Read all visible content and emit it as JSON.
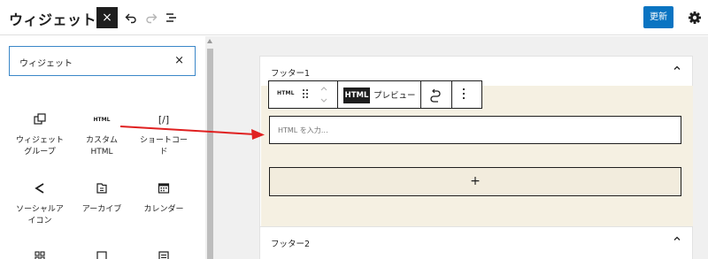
{
  "header": {
    "title": "ウィジェット",
    "close_label": "×",
    "update_label": "更新",
    "icons": [
      "undo-icon",
      "redo-icon",
      "list-view-icon",
      "gear-icon"
    ]
  },
  "sidebar": {
    "search": {
      "value": "ウィジェット",
      "clear_label": "×"
    },
    "blocks": [
      {
        "label": "ウィジェット\nグループ",
        "icon": "group-icon"
      },
      {
        "label": "カスタム\nHTML",
        "icon": "html-icon",
        "icon_text": "HTML"
      },
      {
        "label": "ショートコー\nド",
        "icon": "shortcode-icon",
        "icon_text": "[/]"
      },
      {
        "label": "ソーシャルア\nイコン",
        "icon": "share-icon"
      },
      {
        "label": "アーカイブ",
        "icon": "archive-icon"
      },
      {
        "label": "カレンダー",
        "icon": "calendar-icon"
      }
    ]
  },
  "main": {
    "panels": [
      {
        "title": "フッター1",
        "expanded": true
      },
      {
        "title": "フッター2",
        "expanded": false
      }
    ],
    "toolbar": {
      "block_icon_text": "HTML",
      "tab_html": "HTML",
      "tab_preview": "プレビュー"
    },
    "html_input": {
      "placeholder": "HTML を入力…"
    },
    "add_block_label": "+"
  },
  "colors": {
    "accent": "#0a74c2",
    "annotation_arrow": "#e02020",
    "block_background": "#f5f0e2"
  }
}
